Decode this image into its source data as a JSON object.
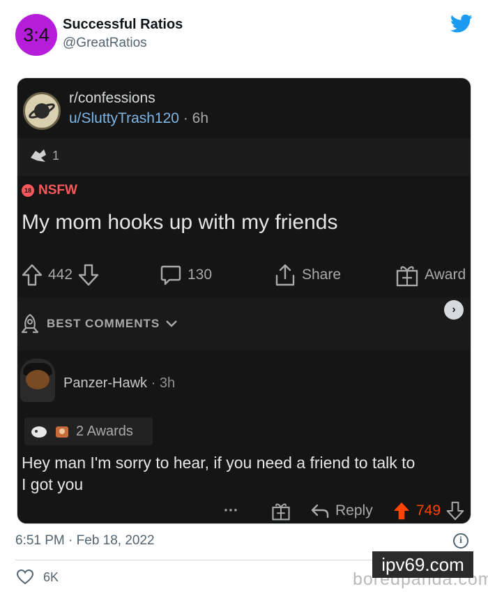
{
  "tweet": {
    "avatar_text": "3:4",
    "avatar_color": "#b61ddb",
    "display_name": "Successful Ratios",
    "handle": "@GreatRatios",
    "platform_icon": "twitter-bird-icon",
    "timestamp": "6:51 PM · Feb 18, 2022",
    "like_count": "6K",
    "accent_color": "#1d9bf0"
  },
  "reddit": {
    "subreddit": "r/confessions",
    "author": "u/SluttyTrash120",
    "author_time": "· 6h",
    "award_count": "1",
    "nsfw_label": "NSFW",
    "nsfw_badge": "18",
    "title": "My mom hooks up with my friends",
    "upvotes": "442",
    "comments": "130",
    "share_label": "Share",
    "award_label": "Award",
    "sort_label": "BEST COMMENTS",
    "comment": {
      "author": "Panzer-Hawk",
      "time": "· 3h",
      "awards": "2 Awards",
      "line1": "Hey man I'm sorry to hear, if you need a friend to talk to",
      "line2": "I got you",
      "more": "···",
      "reply_label": "Reply",
      "score": "749",
      "upvote_color": "#ff4500"
    }
  },
  "watermarks": {
    "site": "ipv69.com",
    "source": "boredpanda.com"
  }
}
